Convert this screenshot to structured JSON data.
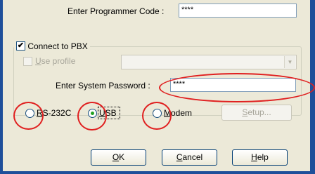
{
  "programmer_code": {
    "label": "Enter Programmer Code :",
    "value": "****"
  },
  "connect_to_pbx": {
    "label": "Connect to PBX",
    "checked": true
  },
  "use_profile": {
    "label_pre": "U",
    "label_post": "se profile",
    "checked": false,
    "selected": ""
  },
  "system_password": {
    "label": "Enter System Password :",
    "value": "****"
  },
  "connection": {
    "rs232c": {
      "label_pre": "R",
      "label_post": "S-232C"
    },
    "usb": {
      "label_pre": "U",
      "label_post": "SB",
      "selected": true
    },
    "modem": {
      "label_pre": "M",
      "label_post": "odem"
    },
    "setup": {
      "label_pre": "S",
      "label_post": "etup..."
    }
  },
  "buttons": {
    "ok": {
      "label_pre": "O",
      "label_post": "K"
    },
    "cancel": {
      "label_pre": "C",
      "label_post": "ancel"
    },
    "help": {
      "label_pre": "H",
      "label_post": "elp"
    }
  },
  "colors": {
    "dialog": "#ece9d8",
    "frame": "#1f4f9a",
    "annotation": "#e02020"
  }
}
